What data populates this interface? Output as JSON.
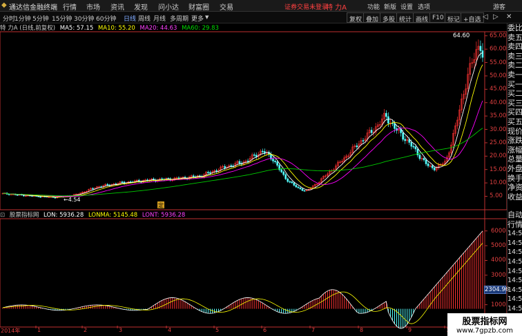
{
  "menubar": {
    "app_title": "通达信金融终端",
    "items": [
      "行情",
      "市场",
      "资讯",
      "发现",
      "问小达",
      "财富圈",
      "交易"
    ],
    "status": "证券交易未登录",
    "stock": "特 力A",
    "right_items": [
      "功能",
      "新版",
      "设置",
      "选项"
    ],
    "guest": "游客"
  },
  "toolbar": {
    "periods": [
      "分时",
      "1分钟",
      "5分钟",
      "15分钟",
      "30分钟",
      "60分钟",
      "日线",
      "周线",
      "月线",
      "多周期",
      "更多"
    ],
    "active": "日线",
    "buttons": [
      "复权",
      "叠加",
      "多股",
      "统计",
      "画线",
      "F10",
      "标记",
      "+自选"
    ]
  },
  "main_legend": {
    "title": "特 力A (日线,前复权)",
    "ma5": "MA5: 57.15",
    "ma10": "MA10: 55.20",
    "ma20": "MA20: 44.63",
    "ma60": "MA60: 29.83"
  },
  "indicator_legend": {
    "name": "股票指标网",
    "lon": "LON: 5936.28",
    "lonma": "LONMA: 5145.48",
    "lont": "LONT: 5936.28"
  },
  "price_axis": [
    "65.00",
    "60.00",
    "55.00",
    "50.00",
    "45.00",
    "40.00",
    "35.00",
    "30.00",
    "25.00",
    "20.00",
    "15.00",
    "10.00",
    "5.00"
  ],
  "ind_axis": [
    "6000",
    "5000",
    "4000",
    "3000",
    "2000",
    "1000"
  ],
  "current_ind": "2304.96",
  "annotations": {
    "high": "64.60",
    "low": "4.54",
    "marker": "定"
  },
  "xaxis": [
    "2014年",
    "1",
    "2",
    "3",
    "4",
    "5",
    "6",
    "7",
    "8",
    "9",
    "10",
    "11"
  ],
  "right_panel": {
    "top": [
      "委比",
      "卖五",
      "卖四",
      "卖三",
      "卖二",
      "卖一",
      "买一",
      "买二",
      "买三",
      "买四",
      "买五",
      "现价",
      "涨跌",
      "涨幅",
      "总量",
      "外盘",
      "换手",
      "净资",
      "收益"
    ],
    "bottom": [
      "自动",
      "行情",
      "14:50",
      "14:50",
      "14:50",
      "14:50",
      "14:50",
      "14:50",
      "14:50",
      "14:50",
      "14:50",
      "14:50",
      "14:50"
    ]
  },
  "watermark": {
    "line1": "股票指标网",
    "line2": "www.7gpzb.com"
  },
  "colors": {
    "up": "#ff3232",
    "down": "#54ffff",
    "ma5": "#ffffff",
    "ma10": "#ffff00",
    "ma20": "#ff00ff",
    "ma60": "#00cc00",
    "axis": "#c03030"
  }
}
